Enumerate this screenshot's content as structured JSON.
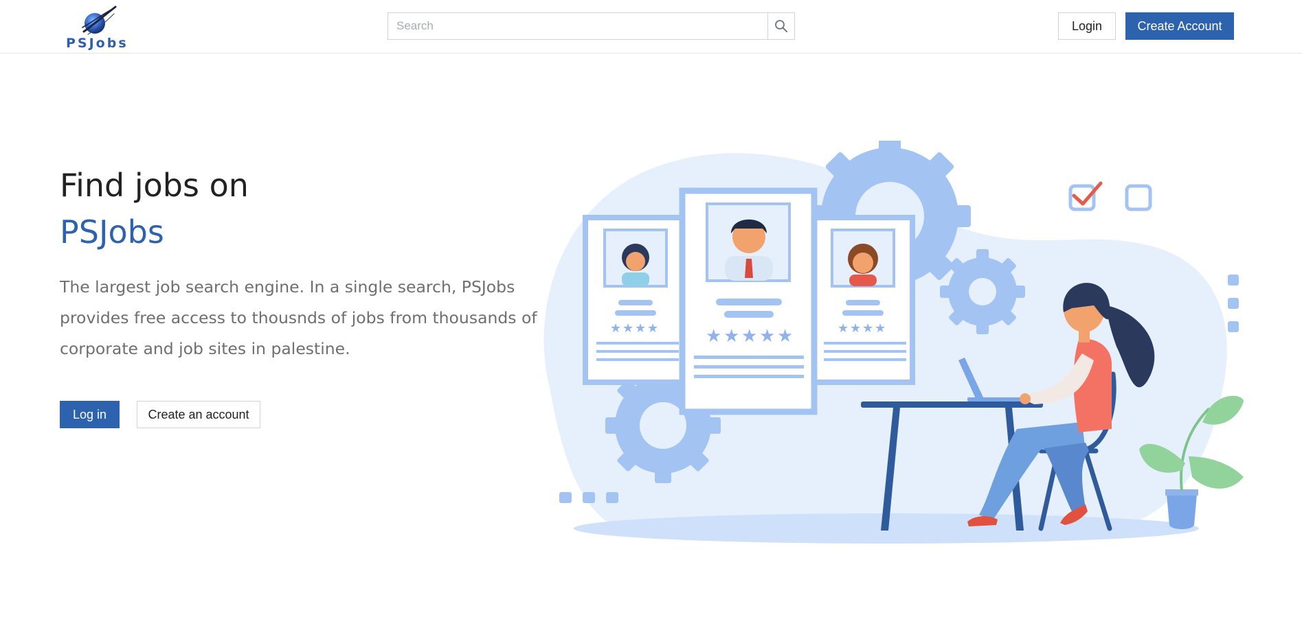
{
  "header": {
    "logo_text": "PSJobs",
    "search": {
      "placeholder": "Search",
      "value": ""
    },
    "login_label": "Login",
    "create_account_label": "Create Account"
  },
  "hero": {
    "title_line1": "Find jobs on",
    "title_brand": "PSJobs",
    "description": "The largest job search engine. In a single search, PSJobs provides free access to thousnds of jobs from thousands of corporate and job sites in palestine.",
    "login_label": "Log in",
    "create_account_label": "Create an account"
  },
  "icons": {
    "logo": "psjobs-logo-globe-icon",
    "search": "search-icon",
    "illustration": "job-search-illustration"
  },
  "colors": {
    "brand_blue": "#2d63ae",
    "illustration_light": "#e6f0fc",
    "illustration_mid": "#a3c4f3",
    "illustration_dark": "#2f5a9c"
  }
}
